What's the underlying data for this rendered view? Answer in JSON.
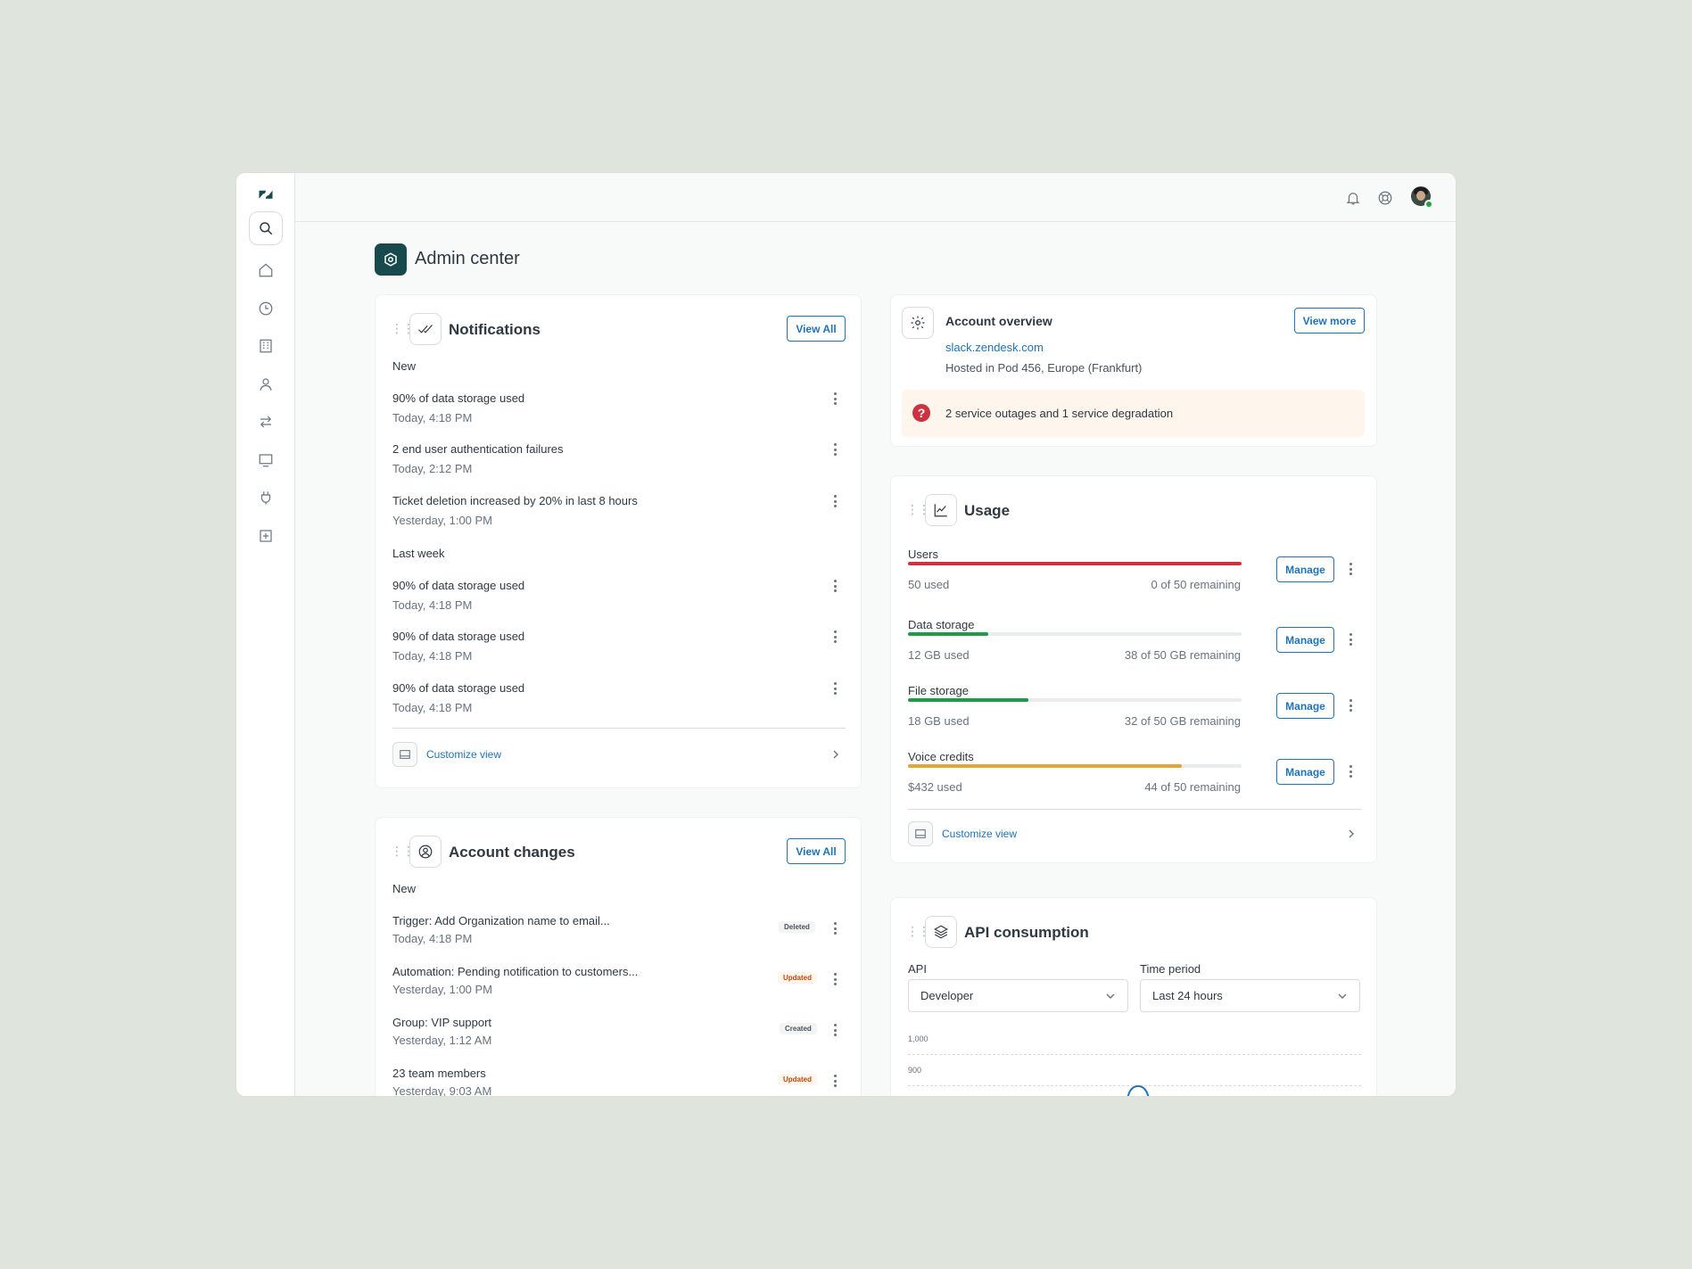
{
  "app": {
    "page_title": "Admin center"
  },
  "sidebar": {
    "items": [
      {
        "name": "home",
        "icon": "home-icon"
      },
      {
        "name": "recent",
        "icon": "clock-icon"
      },
      {
        "name": "organizations",
        "icon": "building-icon"
      },
      {
        "name": "people",
        "icon": "person-icon"
      },
      {
        "name": "routing",
        "icon": "arrows-icon"
      },
      {
        "name": "channels",
        "icon": "monitor-icon"
      },
      {
        "name": "apps-integrations",
        "icon": "plug-icon"
      },
      {
        "name": "objects-rules",
        "icon": "plus-box-icon"
      }
    ]
  },
  "notifications": {
    "title": "Notifications",
    "view_all": "View All",
    "new_label": "New",
    "new_items": [
      {
        "title": "90% of data storage used",
        "time": "Today, 4:18 PM"
      },
      {
        "title": "2 end user authentication failures",
        "time": "Today, 2:12 PM"
      },
      {
        "title": "Ticket deletion increased by 20% in last 8 hours",
        "time": "Yesterday, 1:00 PM"
      }
    ],
    "last_week_label": "Last week",
    "last_week_items": [
      {
        "title": "90% of data storage used",
        "time": "Today, 4:18 PM"
      },
      {
        "title": "90% of data storage used",
        "time": "Today, 4:18 PM"
      },
      {
        "title": "90% of data storage used",
        "time": "Today, 4:18 PM"
      }
    ],
    "customize": "Customize view"
  },
  "account_changes": {
    "title": "Account changes",
    "view_all": "View All",
    "new_label": "New",
    "items": [
      {
        "title": "Trigger: Add Organization name to email...",
        "time": "Today, 4:18 PM",
        "badge": "Deleted"
      },
      {
        "title": "Automation: Pending notification to customers...",
        "time": "Yesterday, 1:00 PM",
        "badge": "Updated"
      },
      {
        "title": "Group: VIP support",
        "time": "Yesterday, 1:12 AM",
        "badge": "Created"
      },
      {
        "title": "23 team members",
        "time": "Yesterday, 9:03 AM",
        "badge": "Updated"
      }
    ]
  },
  "account_overview": {
    "title": "Account overview",
    "view_more": "View more",
    "domain": "slack.zendesk.com",
    "hosted": "Hosted in Pod 456, Europe (Frankfurt)",
    "alert": "2 service outages and 1 service degradation",
    "alert_icon": "?"
  },
  "usage": {
    "title": "Usage",
    "manage_label": "Manage",
    "items": [
      {
        "label": "Users",
        "used": "50 used",
        "remaining": "0 of 50 remaining",
        "fraction": 1.0,
        "color": "#cc3340"
      },
      {
        "label": "Data storage",
        "used": "12 GB used",
        "remaining": "38 of 50 GB remaining",
        "fraction": 0.24,
        "color": "#1f9a46"
      },
      {
        "label": "File storage",
        "used": "18 GB used",
        "remaining": "32 of 50 GB remaining",
        "fraction": 0.36,
        "color": "#1f9a46"
      },
      {
        "label": "Voice credits",
        "used": "$432 used",
        "remaining": "44 of 50 remaining",
        "fraction": 0.82,
        "color": "#e2a632"
      }
    ],
    "customize": "Customize view"
  },
  "api_consumption": {
    "title": "API consumption",
    "api_label": "API",
    "api_value": "Developer",
    "period_label": "Time period",
    "period_value": "Last 24 hours",
    "y_ticks": [
      "1,000",
      "900"
    ]
  }
}
